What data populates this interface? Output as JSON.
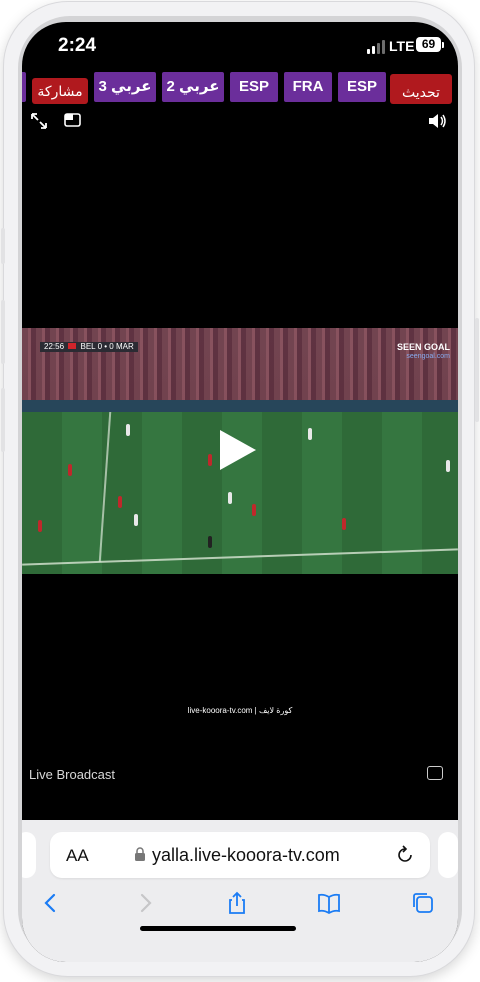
{
  "status_bar": {
    "time": "2:24",
    "network": "LTE",
    "battery": "69"
  },
  "channels": {
    "share_label": "مشاركة",
    "refresh_label": "تحديث",
    "tabs": [
      "عربي 3",
      "عربي 2",
      "ESP",
      "FRA",
      "ESP"
    ]
  },
  "video": {
    "scoreboard": {
      "clock": "22:56",
      "home": "BEL",
      "home_score": "0",
      "away_score": "0",
      "away": "MAR"
    },
    "broadcaster_logo": "SEEN GOAL",
    "broadcaster_sub": "seengoal.com",
    "watermark": "live-kooora-tv.com | كورة لايف"
  },
  "overlay": {
    "live_broadcast": "Live Broadcast"
  },
  "safari": {
    "text_size_label": "AA",
    "url": "yalla.live-kooora-tv.com"
  },
  "colors": {
    "chip_purple": "#6b2e9b",
    "chip_red": "#b0191e",
    "safari_blue": "#1b7cf4"
  }
}
